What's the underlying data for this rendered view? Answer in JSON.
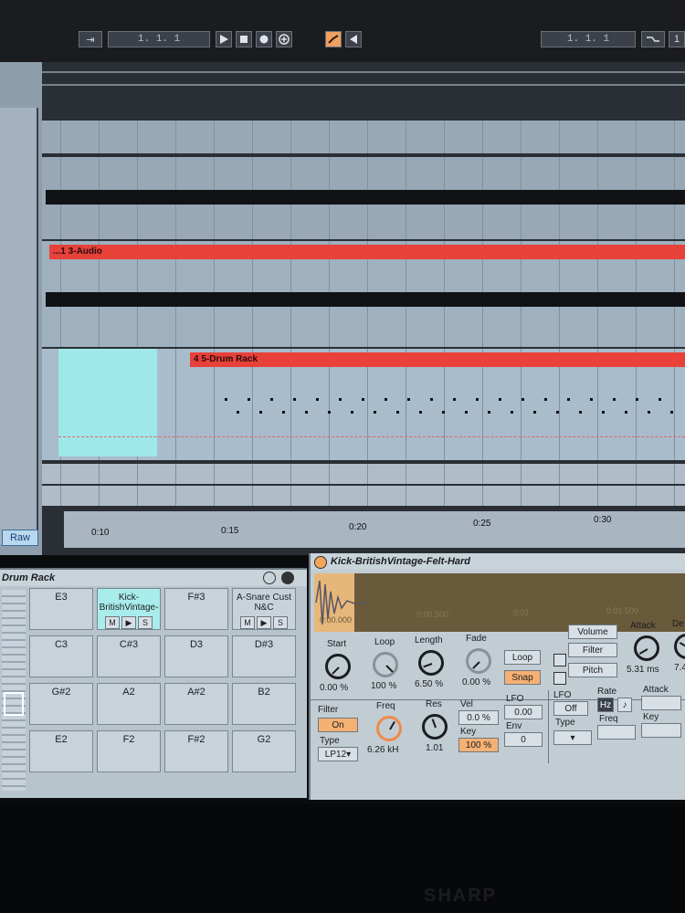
{
  "transport": {
    "position_left": "1.   1.   1",
    "position_right": "1.   1.   1"
  },
  "tracks": {
    "audio_clip": "...1 3-Audio",
    "drum_clip": "4 5-Drum Rack"
  },
  "ruler": {
    "labels": [
      "0:10",
      "0:15",
      "0:20",
      "0:25",
      "0:30"
    ]
  },
  "left_panel": {
    "raw_button": "Raw"
  },
  "drum_rack": {
    "title": "Drum Rack",
    "pads": [
      {
        "label": "E3"
      },
      {
        "label": "Kick-BritishVintage-"
      },
      {
        "label": "F#3"
      },
      {
        "label": "A-Snare Cust N&C"
      },
      {
        "label": "C3"
      },
      {
        "label": "C#3"
      },
      {
        "label": "D3"
      },
      {
        "label": "D#3"
      },
      {
        "label": "G#2"
      },
      {
        "label": "A2"
      },
      {
        "label": "A#2"
      },
      {
        "label": "B2"
      },
      {
        "label": "E2"
      },
      {
        "label": "F2"
      },
      {
        "label": "F#2"
      },
      {
        "label": "G2"
      }
    ],
    "pad_controls": {
      "mute": "M",
      "play": "▶",
      "solo": "S"
    }
  },
  "simpler": {
    "title": "Kick-BritishVintage-Felt-Hard",
    "start_label": "Start",
    "start_value": "0.00 %",
    "loop_label": "Loop",
    "loop_value": "100 %",
    "length_label": "Length",
    "length_value": "6.50 %",
    "fade_label": "Fade",
    "fade_value": "0.00 %",
    "loop_button": "Loop",
    "snap_button": "Snap",
    "volume_button": "Volume",
    "filter_button": "Filter",
    "pitch_button": "Pitch",
    "attack_label": "Attack",
    "attack_value": "5.31 ms",
    "attack_value_right": "7.4",
    "decay_label_partial": "De",
    "filter_label": "Filter",
    "filter_on": "On",
    "type_label": "Type",
    "type_value": "LP12",
    "freq_label": "Freq",
    "freq_value": "6.26 kH",
    "res_label": "Res",
    "res_value": "1.01",
    "vel_label": "Vel",
    "vel_value": "0.0 %",
    "key_label": "Key",
    "key_value": "100 %",
    "lfo_label": "LFO",
    "lfo_value": "0.00",
    "env_label": "Env",
    "env_value": "0",
    "lfo2_label": "LFO",
    "lfo2_value": "Off",
    "type2_label": "Type",
    "rate_label": "Rate",
    "rate_hz": "Hz",
    "freq2_label": "Freq",
    "attack2_label": "Attack",
    "key2_label": "Key",
    "waveform_times": [
      "0:00.000",
      "0:00.500",
      "0:01",
      "0:01.500"
    ]
  },
  "brand": "SHARP",
  "colors": {
    "clip": "#e8413a",
    "selection": "#9ee8ea",
    "accent": "#f5b074"
  }
}
